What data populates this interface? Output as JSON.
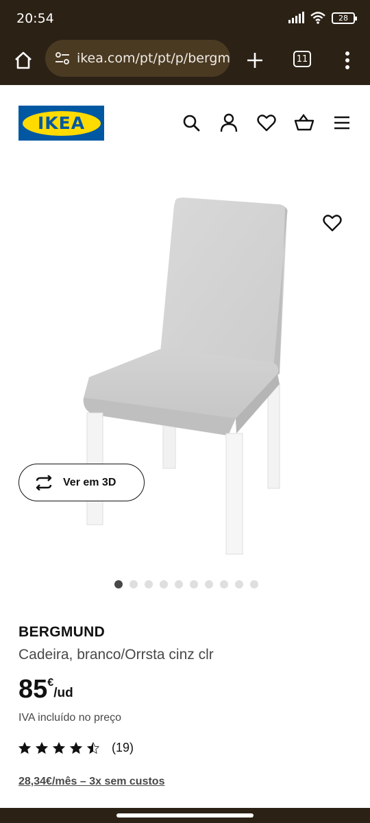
{
  "status_bar": {
    "time": "20:54",
    "battery": "28",
    "icons": [
      "signal-icon",
      "wifi-icon",
      "battery-icon"
    ]
  },
  "browser": {
    "url": "ikea.com/pt/pt/p/bergm",
    "tab_count": "11",
    "icons": [
      "home-icon",
      "site-settings-icon",
      "plus-icon",
      "tabs-icon",
      "more-vert-icon"
    ]
  },
  "site_header": {
    "logo_text": "IKEA",
    "logo_colors": {
      "blue": "#0058a3",
      "yellow": "#ffdb00"
    },
    "icons": [
      "search-icon",
      "account-icon",
      "favourites-icon",
      "cart-icon",
      "menu-icon"
    ]
  },
  "gallery": {
    "image_count": 10,
    "active_index": 0,
    "view3d_label": "Ver em 3D"
  },
  "product": {
    "name": "BERGMUND",
    "description": "Cadeira, branco/Orrsta cinz clr",
    "price_integer": "85",
    "currency": "€",
    "price_unit": "/ud",
    "vat_note": "IVA incluído no preço",
    "rating": 4.5,
    "rating_max": 5,
    "review_count": "(19)",
    "installment": "28,34€/mês – 3x sem custos"
  }
}
